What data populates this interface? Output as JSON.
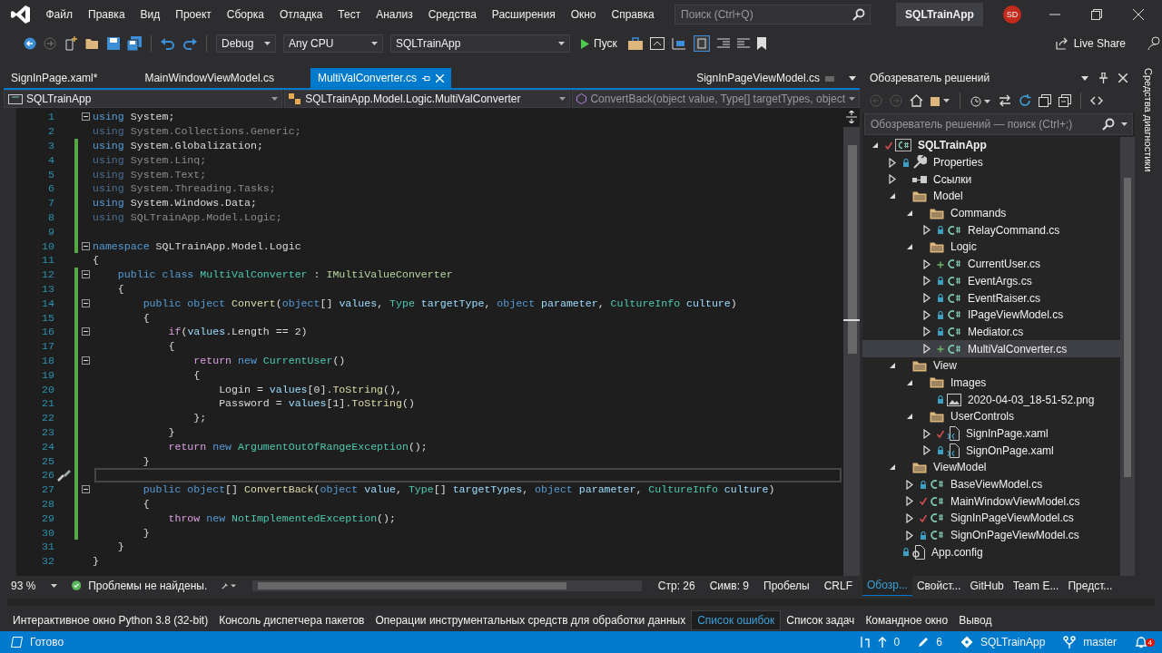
{
  "window": {
    "title": "SQLTrainApp",
    "avatar": "SD"
  },
  "menu": [
    "Файл",
    "Правка",
    "Вид",
    "Проект",
    "Сборка",
    "Отладка",
    "Тест",
    "Анализ",
    "Средства",
    "Расширения",
    "Окно",
    "Справка"
  ],
  "search": {
    "placeholder": "Поиск (Ctrl+Q)"
  },
  "toolbar": {
    "dropdowns": [
      "Debug",
      "Any CPU",
      "SQLTrainApp"
    ],
    "run_label": "Пуск",
    "live_share": "Live Share"
  },
  "tabs": [
    {
      "label": "SignInPage.xaml*",
      "selected": false
    },
    {
      "label": "MainWindowViewModel.cs",
      "selected": false
    },
    {
      "label": "MultiValConverter.cs",
      "selected": true
    }
  ],
  "preview_tab": {
    "label": "SignInPageViewModel.cs"
  },
  "nav_bar": [
    "SQLTrainApp",
    "SQLTrainApp.Model.Logic.MultiValConverter",
    "ConvertBack(object value, Type[] targetTypes, object"
  ],
  "code": [
    {
      "number": "1",
      "changed": false,
      "current": false,
      "fold": true,
      "tokens": [
        {
          "kind": "kw",
          "text": "using"
        },
        {
          "kind": "plain",
          "text": " System;"
        }
      ]
    },
    {
      "number": "2",
      "changed": false,
      "current": false,
      "fold": false,
      "tokens": [
        {
          "kind": "dimkw",
          "text": "using"
        },
        {
          "kind": "dim",
          "text": " System.Collections.Generic;"
        }
      ]
    },
    {
      "number": "3",
      "changed": true,
      "current": false,
      "fold": false,
      "tokens": [
        {
          "kind": "kw",
          "text": "using"
        },
        {
          "kind": "plain",
          "text": " System.Globalization;"
        }
      ]
    },
    {
      "number": "4",
      "changed": true,
      "current": false,
      "fold": false,
      "tokens": [
        {
          "kind": "dimkw",
          "text": "using"
        },
        {
          "kind": "dim",
          "text": " System.Linq;"
        }
      ]
    },
    {
      "number": "5",
      "changed": true,
      "current": false,
      "fold": false,
      "tokens": [
        {
          "kind": "dimkw",
          "text": "using"
        },
        {
          "kind": "dim",
          "text": " System.Text;"
        }
      ]
    },
    {
      "number": "6",
      "changed": true,
      "current": false,
      "fold": false,
      "tokens": [
        {
          "kind": "dimkw",
          "text": "using"
        },
        {
          "kind": "dim",
          "text": " System.Threading.Tasks;"
        }
      ]
    },
    {
      "number": "7",
      "changed": true,
      "current": false,
      "fold": false,
      "tokens": [
        {
          "kind": "kw",
          "text": "using"
        },
        {
          "kind": "plain",
          "text": " System.Windows.Data;"
        }
      ]
    },
    {
      "number": "8",
      "changed": true,
      "current": false,
      "fold": false,
      "tokens": [
        {
          "kind": "dimkw",
          "text": "using"
        },
        {
          "kind": "dim",
          "text": " SQLTrainApp.Model.Logic;"
        }
      ]
    },
    {
      "number": "9",
      "changed": true,
      "current": false,
      "fold": false
    },
    {
      "number": "10",
      "changed": true,
      "current": false,
      "fold": true,
      "tokens": [
        {
          "kind": "kw",
          "text": "namespace"
        },
        {
          "kind": "plain",
          "text": " SQLTrainApp.Model.Logic"
        }
      ]
    },
    {
      "number": "11",
      "changed": false,
      "current": false,
      "fold": false,
      "tokens": [
        {
          "kind": "plain",
          "text": "{"
        }
      ]
    },
    {
      "number": "12",
      "changed": true,
      "current": false,
      "fold": true,
      "tokens": [
        {
          "kind": "kw",
          "text": "    public class"
        },
        {
          "kind": "type",
          "text": " MultiValConverter"
        },
        {
          "kind": "plain",
          "text": " : "
        },
        {
          "kind": "iface",
          "text": "IMultiValueConverter"
        }
      ]
    },
    {
      "number": "13",
      "changed": true,
      "current": false,
      "fold": false,
      "tokens": [
        {
          "kind": "plain",
          "text": "    {"
        }
      ]
    },
    {
      "number": "14",
      "changed": true,
      "current": false,
      "fold": true,
      "tokens": [
        {
          "kind": "kw",
          "text": "        public object"
        },
        {
          "kind": "method",
          "text": " Convert"
        },
        {
          "kind": "plain",
          "text": "("
        },
        {
          "kind": "kw",
          "text": "object"
        },
        {
          "kind": "plain",
          "text": "[] "
        },
        {
          "kind": "param",
          "text": "values"
        },
        {
          "kind": "plain",
          "text": ", "
        },
        {
          "kind": "type",
          "text": "Type"
        },
        {
          "kind": "param",
          "text": " targetType"
        },
        {
          "kind": "plain",
          "text": ", "
        },
        {
          "kind": "kw",
          "text": "object"
        },
        {
          "kind": "param",
          "text": " parameter"
        },
        {
          "kind": "plain",
          "text": ", "
        },
        {
          "kind": "type",
          "text": "CultureInfo"
        },
        {
          "kind": "param",
          "text": " culture"
        },
        {
          "kind": "plain",
          "text": ")"
        }
      ]
    },
    {
      "number": "15",
      "changed": true,
      "current": false,
      "fold": false,
      "tokens": [
        {
          "kind": "plain",
          "text": "        {"
        }
      ]
    },
    {
      "number": "16",
      "changed": true,
      "current": false,
      "fold": true,
      "tokens": [
        {
          "kind": "ctrl",
          "text": "            if"
        },
        {
          "kind": "plain",
          "text": "("
        },
        {
          "kind": "param",
          "text": "values"
        },
        {
          "kind": "plain",
          "text": ".Length == 2)"
        }
      ]
    },
    {
      "number": "17",
      "changed": true,
      "current": false,
      "fold": false,
      "tokens": [
        {
          "kind": "plain",
          "text": "            {"
        }
      ]
    },
    {
      "number": "18",
      "changed": true,
      "current": false,
      "fold": true,
      "tokens": [
        {
          "kind": "ctrl",
          "text": "                return"
        },
        {
          "kind": "kw",
          "text": " new"
        },
        {
          "kind": "type",
          "text": " CurrentUser"
        },
        {
          "kind": "plain",
          "text": "()"
        }
      ]
    },
    {
      "number": "19",
      "changed": true,
      "current": false,
      "fold": false,
      "tokens": [
        {
          "kind": "plain",
          "text": "                {"
        }
      ]
    },
    {
      "number": "20",
      "changed": true,
      "current": false,
      "fold": false,
      "tokens": [
        {
          "kind": "plain",
          "text": "                    Login = "
        },
        {
          "kind": "param",
          "text": "values"
        },
        {
          "kind": "plain",
          "text": "[0]."
        },
        {
          "kind": "method",
          "text": "ToString"
        },
        {
          "kind": "plain",
          "text": "(),"
        }
      ]
    },
    {
      "number": "21",
      "changed": true,
      "current": false,
      "fold": false,
      "tokens": [
        {
          "kind": "plain",
          "text": "                    Password = "
        },
        {
          "kind": "param",
          "text": "values"
        },
        {
          "kind": "plain",
          "text": "[1]."
        },
        {
          "kind": "method",
          "text": "ToString"
        },
        {
          "kind": "plain",
          "text": "()"
        }
      ]
    },
    {
      "number": "22",
      "changed": true,
      "current": false,
      "fold": false,
      "tokens": [
        {
          "kind": "plain",
          "text": "                };"
        }
      ]
    },
    {
      "number": "23",
      "changed": true,
      "current": false,
      "fold": false,
      "tokens": [
        {
          "kind": "plain",
          "text": "            }"
        }
      ]
    },
    {
      "number": "24",
      "changed": true,
      "current": false,
      "fold": false,
      "tokens": [
        {
          "kind": "ctrl",
          "text": "            return"
        },
        {
          "kind": "kw",
          "text": " new"
        },
        {
          "kind": "type",
          "text": " ArgumentOutOfRangeException"
        },
        {
          "kind": "plain",
          "text": "();"
        }
      ]
    },
    {
      "number": "25",
      "changed": true,
      "current": false,
      "fold": false,
      "tokens": [
        {
          "kind": "plain",
          "text": "        }"
        }
      ]
    },
    {
      "number": "26",
      "changed": true,
      "current": true,
      "fold": false,
      "quick_action": true
    },
    {
      "number": "27",
      "changed": true,
      "current": false,
      "fold": true,
      "tokens": [
        {
          "kind": "kw",
          "text": "        public object"
        },
        {
          "kind": "plain",
          "text": "[] "
        },
        {
          "kind": "method",
          "text": "ConvertBack"
        },
        {
          "kind": "plain",
          "text": "("
        },
        {
          "kind": "kw",
          "text": "object"
        },
        {
          "kind": "param",
          "text": " value"
        },
        {
          "kind": "plain",
          "text": ", "
        },
        {
          "kind": "type",
          "text": "Type"
        },
        {
          "kind": "plain",
          "text": "[] "
        },
        {
          "kind": "param",
          "text": "targetTypes"
        },
        {
          "kind": "plain",
          "text": ", "
        },
        {
          "kind": "kw",
          "text": "object"
        },
        {
          "kind": "param",
          "text": " parameter"
        },
        {
          "kind": "plain",
          "text": ", "
        },
        {
          "kind": "type",
          "text": "CultureInfo"
        },
        {
          "kind": "param",
          "text": " culture"
        },
        {
          "kind": "plain",
          "text": ")"
        }
      ]
    },
    {
      "number": "28",
      "changed": true,
      "current": false,
      "fold": false,
      "tokens": [
        {
          "kind": "plain",
          "text": "        {"
        }
      ]
    },
    {
      "number": "29",
      "changed": true,
      "current": false,
      "fold": false,
      "tokens": [
        {
          "kind": "ctrl",
          "text": "            throw"
        },
        {
          "kind": "kw",
          "text": " new"
        },
        {
          "kind": "type",
          "text": " NotImplementedException"
        },
        {
          "kind": "plain",
          "text": "();"
        }
      ]
    },
    {
      "number": "30",
      "changed": true,
      "current": false,
      "fold": false,
      "tokens": [
        {
          "kind": "plain",
          "text": "        }"
        }
      ]
    },
    {
      "number": "31",
      "changed": false,
      "current": false,
      "fold": false,
      "tokens": [
        {
          "kind": "plain",
          "text": "    }"
        }
      ]
    },
    {
      "number": "32",
      "changed": false,
      "current": false,
      "fold": false,
      "tokens": [
        {
          "kind": "plain",
          "text": "}"
        }
      ]
    }
  ],
  "editor_status": {
    "zoom": "93 %",
    "problems": "Проблемы не найдены.",
    "line": "Стр: 26",
    "col": "Симв: 9",
    "indent": "Пробелы",
    "eol": "CRLF"
  },
  "solution_explorer": {
    "title": "Обозреватель решений",
    "search_placeholder": "Обозреватель решений — поиск (Ctrl+;)",
    "tree": [
      {
        "label": "SQLTrainApp",
        "kind": "project",
        "locked": false,
        "modified": true,
        "added": false,
        "expanded": true,
        "selected": false,
        "children": [
          {
            "label": "Properties",
            "kind": "properties",
            "locked": true,
            "modified": false,
            "added": false,
            "expanded": false,
            "selected": false
          },
          {
            "label": "Ссылки",
            "kind": "references",
            "locked": false,
            "modified": false,
            "added": false,
            "expanded": false,
            "selected": false
          },
          {
            "label": "Model",
            "kind": "folder",
            "locked": false,
            "modified": false,
            "added": false,
            "expanded": true,
            "selected": false,
            "children": [
              {
                "label": "Commands",
                "kind": "folder",
                "locked": false,
                "modified": false,
                "added": false,
                "expanded": true,
                "selected": false,
                "children": [
                  {
                    "label": "RelayCommand.cs",
                    "kind": "cs",
                    "locked": true,
                    "modified": false,
                    "added": false,
                    "expanded": false,
                    "selected": false
                  }
                ]
              },
              {
                "label": "Logic",
                "kind": "folder",
                "locked": false,
                "modified": false,
                "added": false,
                "expanded": true,
                "selected": false,
                "children": [
                  {
                    "label": "CurrentUser.cs",
                    "kind": "cs",
                    "locked": false,
                    "modified": false,
                    "added": true,
                    "expanded": false,
                    "selected": false
                  },
                  {
                    "label": "EventArgs.cs",
                    "kind": "cs",
                    "locked": true,
                    "modified": false,
                    "added": false,
                    "expanded": false,
                    "selected": false
                  },
                  {
                    "label": "EventRaiser.cs",
                    "kind": "cs",
                    "locked": true,
                    "modified": false,
                    "added": false,
                    "expanded": false,
                    "selected": false
                  },
                  {
                    "label": "IPageViewModel.cs",
                    "kind": "cs",
                    "locked": true,
                    "modified": false,
                    "added": false,
                    "expanded": false,
                    "selected": false
                  },
                  {
                    "label": "Mediator.cs",
                    "kind": "cs",
                    "locked": true,
                    "modified": false,
                    "added": false,
                    "expanded": false,
                    "selected": false
                  },
                  {
                    "label": "MultiValConverter.cs",
                    "kind": "cs",
                    "locked": false,
                    "modified": false,
                    "added": true,
                    "expanded": false,
                    "selected": true
                  }
                ]
              }
            ]
          },
          {
            "label": "View",
            "kind": "folder",
            "locked": false,
            "modified": false,
            "added": false,
            "expanded": true,
            "selected": false,
            "children": [
              {
                "label": "Images",
                "kind": "folder",
                "locked": false,
                "modified": false,
                "added": false,
                "expanded": true,
                "selected": false,
                "children": [
                  {
                    "label": "2020-04-03_18-51-52.png",
                    "kind": "image",
                    "locked": true,
                    "modified": false,
                    "added": false,
                    "selected": false
                  }
                ]
              },
              {
                "label": "UserControls",
                "kind": "folder",
                "locked": false,
                "modified": false,
                "added": false,
                "expanded": true,
                "selected": false,
                "children": [
                  {
                    "label": "SignInPage.xaml",
                    "kind": "xaml",
                    "locked": false,
                    "modified": true,
                    "added": false,
                    "expanded": false,
                    "selected": false
                  },
                  {
                    "label": "SignOnPage.xaml",
                    "kind": "xaml",
                    "locked": true,
                    "modified": false,
                    "added": false,
                    "expanded": false,
                    "selected": false
                  }
                ]
              }
            ]
          },
          {
            "label": "ViewModel",
            "kind": "folder",
            "locked": false,
            "modified": false,
            "added": false,
            "expanded": true,
            "selected": false,
            "children": [
              {
                "label": "BaseViewModel.cs",
                "kind": "cs",
                "locked": true,
                "modified": false,
                "added": false,
                "expanded": false,
                "selected": false
              },
              {
                "label": "MainWindowViewModel.cs",
                "kind": "cs",
                "locked": false,
                "modified": true,
                "added": false,
                "expanded": false,
                "selected": false
              },
              {
                "label": "SignInPageViewModel.cs",
                "kind": "cs",
                "locked": false,
                "modified": true,
                "added": false,
                "expanded": false,
                "selected": false
              },
              {
                "label": "SignOnPageViewModel.cs",
                "kind": "cs",
                "locked": true,
                "modified": false,
                "added": false,
                "expanded": false,
                "selected": false
              }
            ]
          },
          {
            "label": "App.config",
            "kind": "config",
            "locked": true,
            "modified": false,
            "added": false,
            "selected": false
          }
        ]
      }
    ],
    "panel_tabs": [
      {
        "label": "Обозр...",
        "selected": true
      },
      {
        "label": "Свойст...",
        "selected": false
      },
      {
        "label": "GitHub",
        "selected": false
      },
      {
        "label": "Team E...",
        "selected": false
      },
      {
        "label": "Предст...",
        "selected": false
      }
    ]
  },
  "side_tab": "Средства диагностики",
  "tool_tabs": [
    {
      "label": "Интерактивное окно Python 3.8 (32-bit)",
      "selected": false
    },
    {
      "label": "Консоль диспетчера пакетов",
      "selected": false
    },
    {
      "label": "Операции инструментальных средств для обработки данных",
      "selected": false
    },
    {
      "label": "Список ошибок",
      "selected": true
    },
    {
      "label": "Список задач",
      "selected": false
    },
    {
      "label": "Командное окно",
      "selected": false
    },
    {
      "label": "Вывод",
      "selected": false
    }
  ],
  "status_bar": {
    "message": "Готово",
    "pending": "0",
    "edits": "6",
    "repo": "SQLTrainApp",
    "branch": "master",
    "notifications": "4"
  }
}
